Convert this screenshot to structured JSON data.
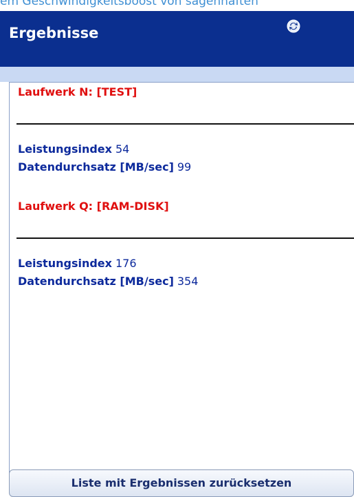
{
  "caption": "em Geschwindigkeitsboost von sagenhaften",
  "header": {
    "title": "Ergebnisse",
    "icon": "refresh-icon"
  },
  "results": {
    "drives": [
      {
        "label": "Laufwerk N: [TEST]",
        "metrics": [
          {
            "label": "Leistungsindex",
            "value": "54"
          },
          {
            "label": "Datendurchsatz [MB/sec]",
            "value": "99"
          }
        ]
      },
      {
        "label": "Laufwerk Q: [RAM-DISK]",
        "metrics": [
          {
            "label": "Leistungsindex",
            "value": "176"
          },
          {
            "label": "Datendurchsatz [MB/sec]",
            "value": "354"
          }
        ]
      }
    ]
  },
  "reset_button": "Liste mit Ergebnissen zurücksetzen",
  "colors": {
    "header_bg": "#0b2f8f",
    "drive_label": "#e01010",
    "metric_text": "#0d2a9c"
  }
}
